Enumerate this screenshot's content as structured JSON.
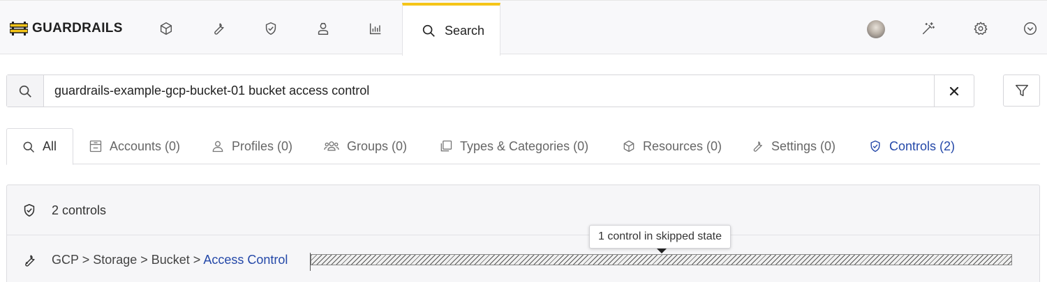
{
  "brand": {
    "name": "GUARDRAILS",
    "accent": "#f5c518",
    "link_color": "#2448a8"
  },
  "nav": {
    "icons": [
      "cube-icon",
      "wrench-icon",
      "shield-check-icon",
      "user-icon",
      "chart-icon"
    ],
    "search_tab_label": "Search",
    "right_icons": [
      "avatar",
      "magic-wand-icon",
      "gear-icon",
      "chevron-down-circle-icon"
    ]
  },
  "search": {
    "query": "guardrails-example-gcp-bucket-01 bucket access control",
    "clear_symbol": "✕"
  },
  "tabs": [
    {
      "label": "All",
      "icon": "search-icon"
    },
    {
      "label": "Accounts (0)",
      "icon": "account-icon"
    },
    {
      "label": "Profiles (0)",
      "icon": "user-icon"
    },
    {
      "label": "Groups (0)",
      "icon": "users-icon"
    },
    {
      "label": "Types & Categories (0)",
      "icon": "copy-icon"
    },
    {
      "label": "Resources (0)",
      "icon": "cube-icon"
    },
    {
      "label": "Settings (0)",
      "icon": "wrench-icon"
    },
    {
      "label": "Controls (2)",
      "icon": "shield-check-icon"
    }
  ],
  "results": {
    "summary": "2 controls",
    "rows": [
      {
        "path": [
          "GCP",
          "Storage",
          "Bucket"
        ],
        "separator": " > ",
        "leaf": "Access Control",
        "tooltip": "1 control in skipped state",
        "state": "skipped"
      }
    ]
  }
}
